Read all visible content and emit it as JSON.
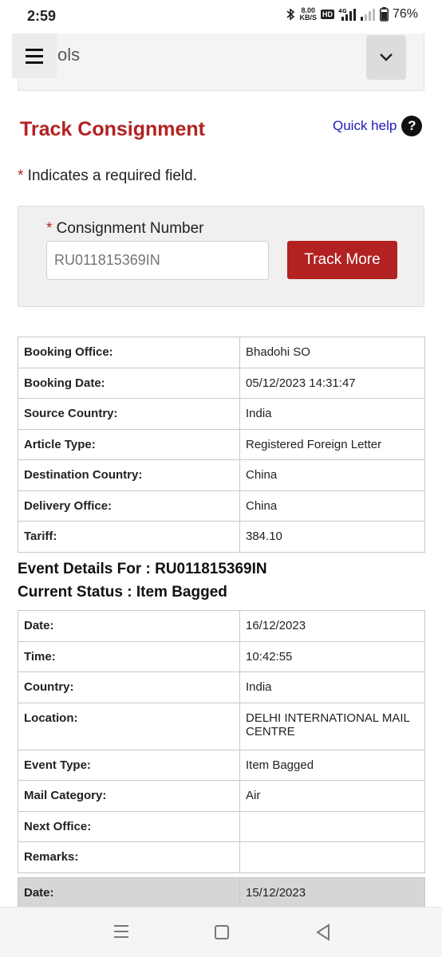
{
  "status_bar": {
    "time": "2:59",
    "speed_value": "8.00",
    "speed_unit": "KB/S",
    "hd_badge": "HD",
    "network": "4G",
    "battery": "76%"
  },
  "tools": {
    "label": "ols"
  },
  "header": {
    "title": "Track Consignment",
    "quick_help": "Quick help",
    "help_icon_glyph": "?"
  },
  "required_note": {
    "asterisk": "*",
    "text": " Indicates a required field."
  },
  "form": {
    "asterisk": "*",
    "label": " Consignment Number",
    "input_placeholder": "RU011815369IN",
    "button_label": "Track More"
  },
  "booking": [
    {
      "k": "Booking Office:",
      "v": "Bhadohi SO"
    },
    {
      "k": "Booking Date:",
      "v": "05/12/2023 14:31:47"
    },
    {
      "k": "Source Country:",
      "v": "India"
    },
    {
      "k": "Article Type:",
      "v": "Registered Foreign Letter"
    },
    {
      "k": "Destination Country:",
      "v": "China"
    },
    {
      "k": "Delivery Office:",
      "v": "China"
    },
    {
      "k": "Tariff:",
      "v": "384.10"
    }
  ],
  "event": {
    "heading": "Event Details For : RU011815369IN",
    "status": "Current Status : Item Bagged",
    "rows": [
      {
        "k": "Date:",
        "v": "16/12/2023"
      },
      {
        "k": "Time:",
        "v": "10:42:55"
      },
      {
        "k": "Country:",
        "v": "India"
      },
      {
        "k": "Location:",
        "v": "DELHI INTERNATIONAL MAIL CENTRE"
      },
      {
        "k": "Event Type:",
        "v": "Item Bagged"
      },
      {
        "k": "Mail Category:",
        "v": "Air"
      },
      {
        "k": "Next Office:",
        "v": ""
      },
      {
        "k": "Remarks:",
        "v": ""
      }
    ],
    "next": {
      "k": "Date:",
      "v": "15/12/2023"
    }
  },
  "colors": {
    "accent_red": "#b22222",
    "link_blue": "#1a1ab8",
    "panel_gray": "#f0f0f0"
  }
}
